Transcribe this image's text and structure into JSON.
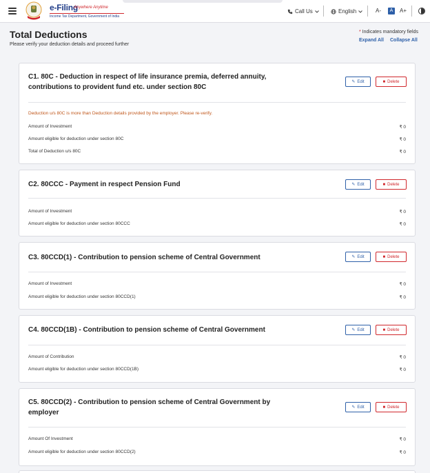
{
  "header": {
    "brand_title": "e-Filing",
    "brand_tagline": "Anywhere Anytime",
    "brand_subtitle": "Income Tax Department, Government of India",
    "call_us": "Call Us",
    "language": "English",
    "font_decrease": "A-",
    "font_normal": "A",
    "font_increase": "A+",
    "icons": [
      "menu-icon",
      "emblem-logo",
      "phone-icon",
      "globe-icon",
      "chevron-down-icon",
      "contrast-icon"
    ]
  },
  "page": {
    "title": "Total Deductions",
    "subtitle": "Please verify your deduction details and proceed further",
    "mandatory_star": "*",
    "mandatory_note": "Indicates mandatory fields",
    "expand_all": "Expand All",
    "collapse_all": "Collapse All"
  },
  "buttons": {
    "edit": "Edit",
    "delete": "Delete",
    "edit_icon": "pencil-icon",
    "delete_icon": "trash-icon"
  },
  "cards": [
    {
      "title_line1": "C1. 80C - Deduction in respect of life insurance premia, deferred annuity,",
      "title_line2": "contributions to provident fund etc. under section 80C",
      "warning": "Deduction u/s 80C is more than Deduction details provided by the employer. Please re-verify.",
      "rows": [
        {
          "label": "Amount of Investment",
          "value": "₹ 0"
        },
        {
          "label": "Amount eligible for deduction under section 80C",
          "value": "₹ 0"
        },
        {
          "label": "Total of Deduction u/s 80C",
          "value": "₹ 0"
        }
      ]
    },
    {
      "title_line1": "C2. 80CCC - Payment in respect Pension Fund",
      "rows": [
        {
          "label": "Amount of Investment",
          "value": "₹ 0"
        },
        {
          "label": "Amount eligible for deduction under section 80CCC",
          "value": "₹ 0"
        }
      ]
    },
    {
      "title_line1": "C3. 80CCD(1) - Contribution to pension scheme of Central Government",
      "rows": [
        {
          "label": "Amount of Investment",
          "value": "₹ 0"
        },
        {
          "label": "Amount eligible for deduction under section 80CCD(1)",
          "value": "₹ 0"
        }
      ]
    },
    {
      "title_line1": "C4. 80CCD(1B) - Contribution to pension scheme of Central Government",
      "rows": [
        {
          "label": "Amount of Contribution",
          "value": "₹ 0"
        },
        {
          "label": "Amount eligible for deduction under section 80CCD(1B)",
          "value": "₹ 0"
        }
      ]
    },
    {
      "title_line1": "C5. 80CCD(2) - Contribution to pension scheme of Central Government by",
      "title_line2": "employer",
      "rows": [
        {
          "label": "Amount Of Investment",
          "value": "₹ 0"
        },
        {
          "label": "Amount eligible for deduction under section 80CCD(2)",
          "value": "₹ 0"
        }
      ]
    }
  ],
  "colors": {
    "primary": "#2d5fa8",
    "danger": "#d0262b",
    "warning": "#c0571b",
    "background": "#f3f4f7"
  }
}
